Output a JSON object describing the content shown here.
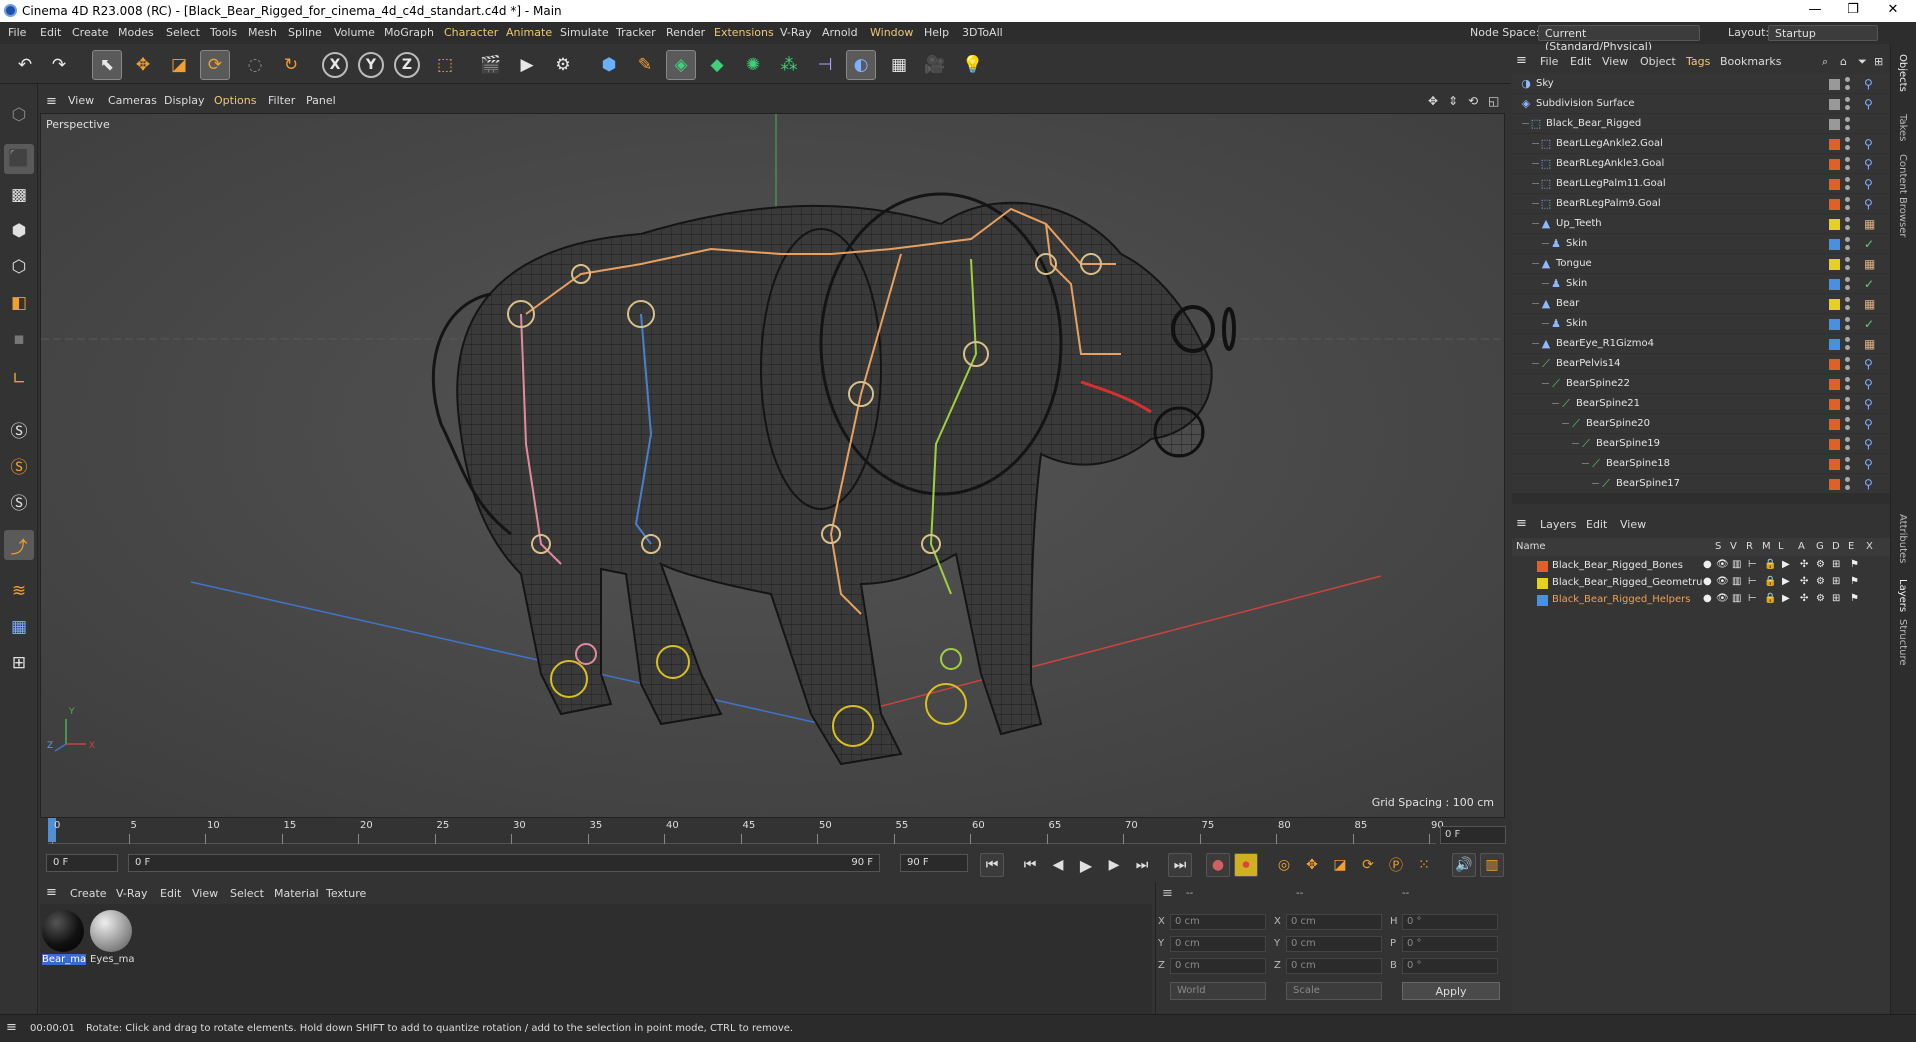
{
  "window": {
    "title": "Cinema 4D R23.008 (RC) - [Black_Bear_Rigged_for_cinema_4d_c4d_standart.c4d *] - Main",
    "controls": [
      "—",
      "❐",
      "✕"
    ]
  },
  "menubar": {
    "items": [
      "File",
      "Edit",
      "Create",
      "Modes",
      "Select",
      "Tools",
      "Mesh",
      "Spline",
      "Volume",
      "MoGraph",
      "Character",
      "Animate",
      "Simulate",
      "Tracker",
      "Render",
      "Extensions",
      "V-Ray",
      "Arnold",
      "Window",
      "Help",
      "3DToAll"
    ],
    "node_space_label": "Node Space:",
    "node_space_value": "Current (Standard/Physical)",
    "layout_label": "Layout:",
    "layout_value": "Startup"
  },
  "viewport": {
    "menu": [
      "View",
      "Cameras",
      "Display",
      "Options",
      "Filter",
      "Panel"
    ],
    "camera_label": "Perspective",
    "grid_spacing": "Grid Spacing : 100 cm",
    "axis_labels": {
      "x": "X",
      "y": "Y",
      "z": "Z"
    }
  },
  "timeline": {
    "ticks": [
      "0",
      "5",
      "10",
      "15",
      "20",
      "25",
      "30",
      "35",
      "40",
      "45",
      "50",
      "55",
      "60",
      "65",
      "70",
      "75",
      "80",
      "85",
      "90"
    ],
    "current_frame_field": "0 F",
    "start_field": "0 F",
    "range_start": "0 F",
    "range_end": "90 F",
    "end_field": "90 F",
    "frame_end_display": "0 F"
  },
  "material_manager": {
    "menu": [
      "Create",
      "V-Ray",
      "Edit",
      "View",
      "Select",
      "Material",
      "Texture"
    ],
    "materials": [
      {
        "name": "Bear_ma",
        "color": "#111111"
      },
      {
        "name": "Eyes_ma",
        "color": "#9a9a9a"
      }
    ]
  },
  "coordinates": {
    "headers": [
      "--",
      "--",
      "--"
    ],
    "rows": [
      {
        "a": "X",
        "av": "0 cm",
        "b": "X",
        "bv": "0 cm",
        "c": "H",
        "cv": "0 °"
      },
      {
        "a": "Y",
        "av": "0 cm",
        "b": "Y",
        "bv": "0 cm",
        "c": "P",
        "cv": "0 °"
      },
      {
        "a": "Z",
        "av": "0 cm",
        "b": "Z",
        "bv": "0 cm",
        "c": "B",
        "cv": "0 °"
      }
    ],
    "mode": "World",
    "scale": "Scale",
    "apply": "Apply"
  },
  "statusbar": {
    "time": "00:00:01",
    "message": "Rotate: Click and drag to rotate elements. Hold down SHIFT to add to quantize rotation / add to the selection in point mode, CTRL to remove."
  },
  "object_manager": {
    "menu": [
      "File",
      "Edit",
      "View",
      "Object",
      "Tags",
      "Bookmarks"
    ],
    "objects": [
      {
        "name": "Sky",
        "depth": 0,
        "icon": "sky-icon",
        "color": "#999999"
      },
      {
        "name": "Subdivision Surface",
        "depth": 0,
        "icon": "subdivision-icon",
        "color": "#999999"
      },
      {
        "name": "Black_Bear_Rigged",
        "depth": 1,
        "icon": "null-icon",
        "color": "#999999"
      },
      {
        "name": "BearLLegAnkle2.Goal",
        "depth": 2,
        "icon": "null-icon",
        "color": "#e0602a"
      },
      {
        "name": "BearRLegAnkle3.Goal",
        "depth": 2,
        "icon": "null-icon",
        "color": "#e0602a"
      },
      {
        "name": "BearLLegPalm11.Goal",
        "depth": 2,
        "icon": "null-icon",
        "color": "#e0602a"
      },
      {
        "name": "BearRLegPalm9.Goal",
        "depth": 2,
        "icon": "null-icon",
        "color": "#e0602a"
      },
      {
        "name": "Up_Teeth",
        "depth": 2,
        "icon": "polygon-icon",
        "color": "#e6d020"
      },
      {
        "name": "Skin",
        "depth": 3,
        "icon": "skin-icon",
        "color": "#4a8fe0"
      },
      {
        "name": "Tongue",
        "depth": 2,
        "icon": "polygon-icon",
        "color": "#e6d020"
      },
      {
        "name": "Skin",
        "depth": 3,
        "icon": "skin-icon",
        "color": "#4a8fe0"
      },
      {
        "name": "Bear",
        "depth": 2,
        "icon": "polygon-icon",
        "color": "#e6d020"
      },
      {
        "name": "Skin",
        "depth": 3,
        "icon": "skin-icon",
        "color": "#4a8fe0"
      },
      {
        "name": "BearEye_R1Gizmo4",
        "depth": 2,
        "icon": "polygon-icon",
        "color": "#4a8fe0"
      },
      {
        "name": "BearPelvis14",
        "depth": 2,
        "icon": "joint-icon",
        "color": "#e0602a"
      },
      {
        "name": "BearSpine22",
        "depth": 3,
        "icon": "joint-icon",
        "color": "#e0602a"
      },
      {
        "name": "BearSpine21",
        "depth": 4,
        "icon": "joint-icon",
        "color": "#e0602a"
      },
      {
        "name": "BearSpine20",
        "depth": 5,
        "icon": "joint-icon",
        "color": "#e0602a"
      },
      {
        "name": "BearSpine19",
        "depth": 6,
        "icon": "joint-icon",
        "color": "#e0602a"
      },
      {
        "name": "BearSpine18",
        "depth": 7,
        "icon": "joint-icon",
        "color": "#e0602a"
      },
      {
        "name": "BearSpine17",
        "depth": 8,
        "icon": "joint-icon",
        "color": "#e0602a"
      }
    ]
  },
  "layers": {
    "menu": [
      "Layers",
      "Edit",
      "View"
    ],
    "columns": [
      "Name",
      "S",
      "V",
      "R",
      "M",
      "L",
      "A",
      "G",
      "D",
      "E",
      "X"
    ],
    "items": [
      {
        "name": "Black_Bear_Rigged_Bones",
        "color": "#e0602a",
        "active": false
      },
      {
        "name": "Black_Bear_Rigged_Geometru",
        "color": "#e6d020",
        "active": false
      },
      {
        "name": "Black_Bear_Rigged_Helpers",
        "color": "#4a8fe0",
        "active": true
      }
    ]
  },
  "right_tabs": [
    "Objects",
    "Takes",
    "Content Browser",
    "Attributes",
    "Layers",
    "Structure"
  ]
}
